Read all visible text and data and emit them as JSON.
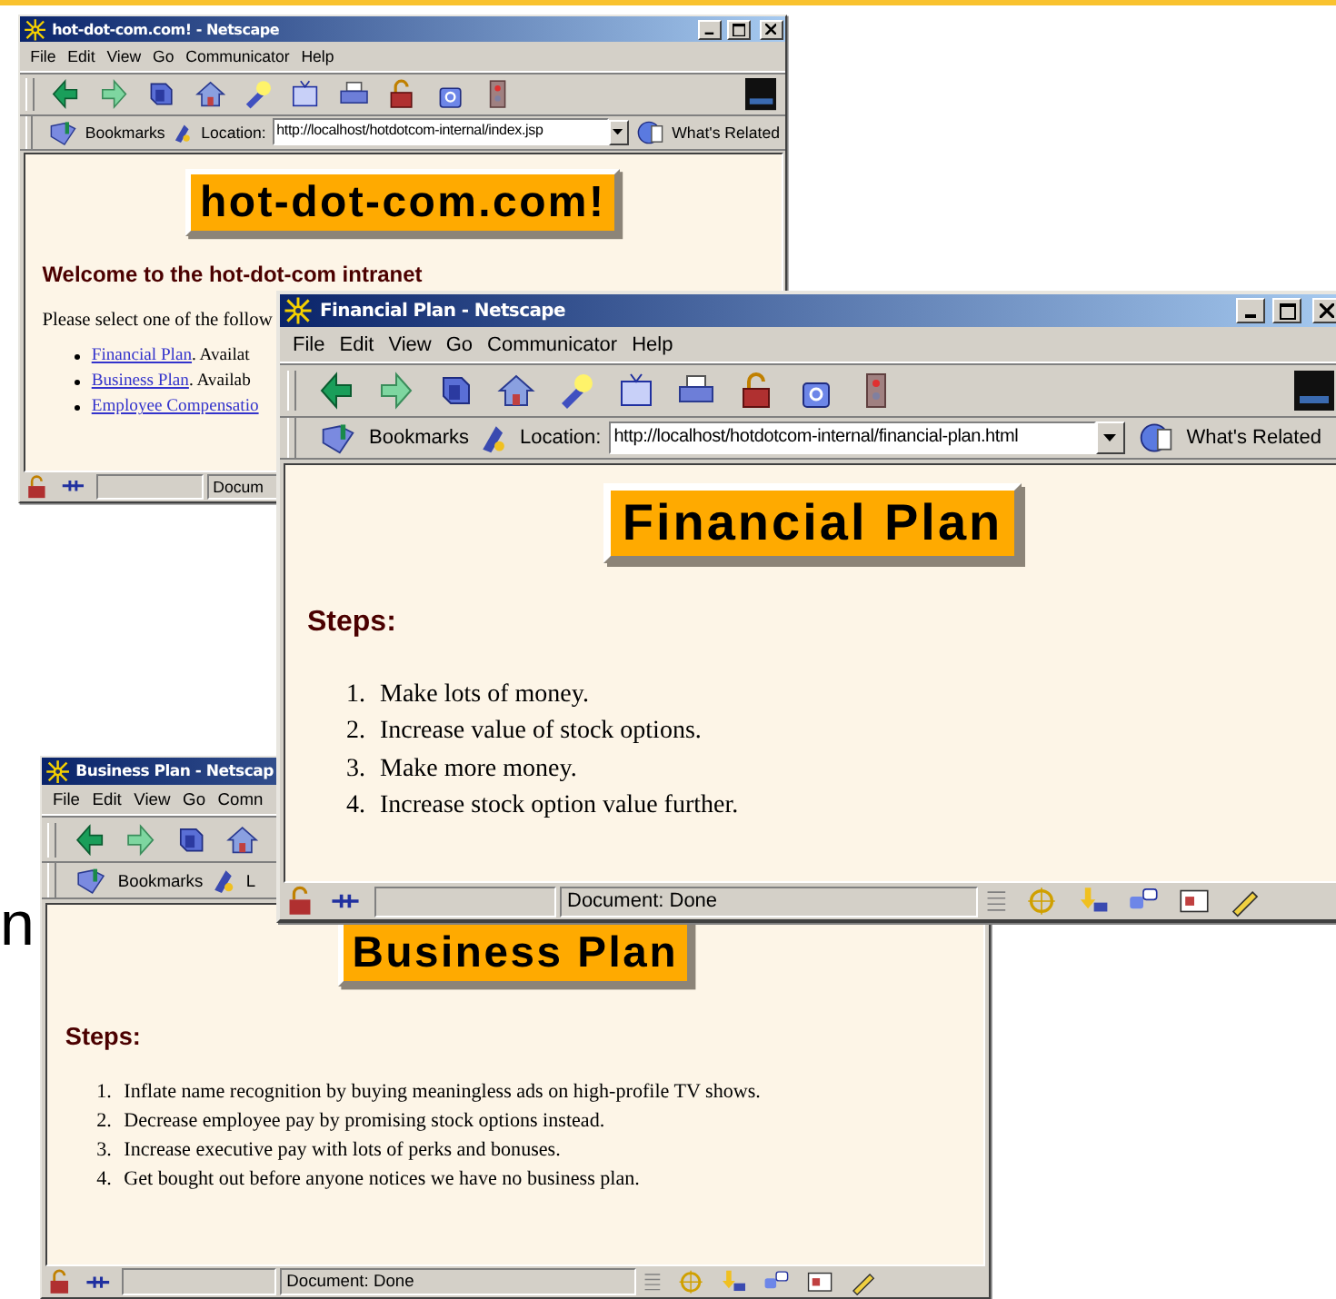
{
  "slide": {
    "side_text": "n"
  },
  "windows": [
    {
      "title": "hot-dot-com.com! - Netscape",
      "menu": [
        "File",
        "Edit",
        "View",
        "Go",
        "Communicator",
        "Help"
      ],
      "bookmarks_label": "Bookmarks",
      "location_label": "Location:",
      "url": "http://localhost/hotdotcom-internal/index.jsp",
      "related_label": "What's Related",
      "page": {
        "banner": "hot-dot-com.com!",
        "heading": "Welcome to the hot-dot-com intranet",
        "intro": "Please select one of the follow",
        "items": [
          {
            "link": "Financial Plan",
            "rest": ". Availat"
          },
          {
            "link": "Business Plan",
            "rest": ". Availab"
          },
          {
            "link": "Employee Compensatio"
          }
        ]
      },
      "status": "Docum"
    },
    {
      "title": "Financial Plan - Netscape",
      "menu": [
        "File",
        "Edit",
        "View",
        "Go",
        "Communicator",
        "Help"
      ],
      "bookmarks_label": "Bookmarks",
      "location_label": "Location:",
      "url": "http://localhost/hotdotcom-internal/financial-plan.html",
      "related_label": "What's Related",
      "page": {
        "banner": "Financial Plan",
        "heading": "Steps:",
        "items": [
          {
            "number": "1.",
            "text": "Make lots of money."
          },
          {
            "number": "2.",
            "text": "Increase value of stock options."
          },
          {
            "number": "3.",
            "text": "Make more money."
          },
          {
            "number": "4.",
            "text": "Increase stock option value further."
          }
        ]
      },
      "status": "Document: Done"
    },
    {
      "title": "Business Plan - Netscap",
      "menu": [
        "File",
        "Edit",
        "View",
        "Go",
        "Comn"
      ],
      "bookmarks_label": "Bookmarks",
      "location_label": "L",
      "page": {
        "banner": "Business Plan",
        "heading": "Steps:",
        "items": [
          {
            "number": "1.",
            "text": "Inflate name recognition by buying meaningless ads on high-profile TV shows."
          },
          {
            "number": "2.",
            "text": "Decrease employee pay by promising stock options instead."
          },
          {
            "number": "3.",
            "text": "Increase executive pay with lots of perks and bonuses."
          },
          {
            "number": "4.",
            "text": "Get bought out before anyone notices we have no business plan."
          }
        ]
      },
      "status": "Document: Done"
    }
  ]
}
